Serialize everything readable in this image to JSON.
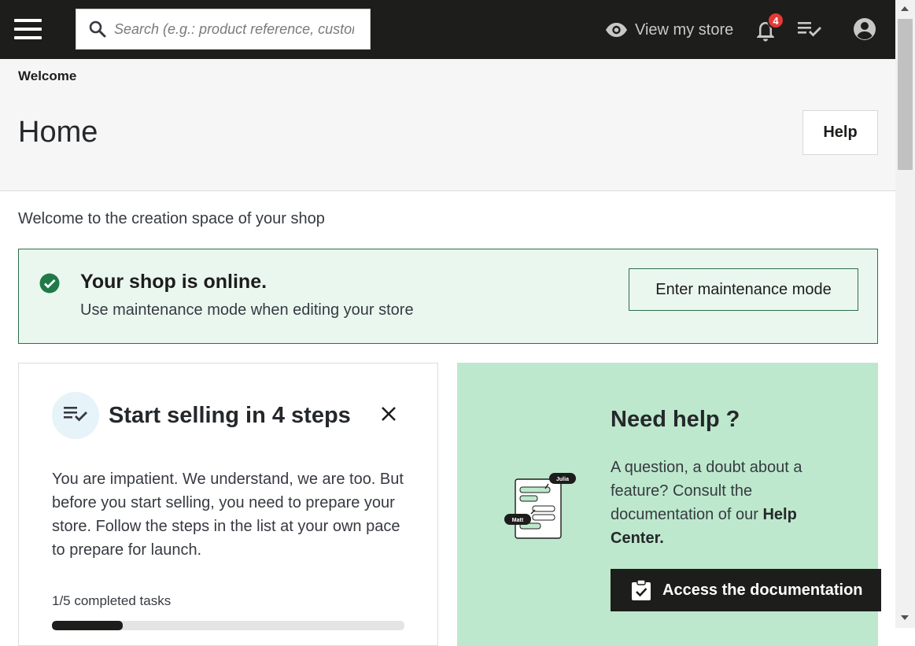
{
  "topbar": {
    "search_placeholder": "Search (e.g.: product reference, customer name…)",
    "view_store_label": "View my store",
    "notifications_count": "4"
  },
  "header": {
    "breadcrumb": "Welcome",
    "title": "Home",
    "help_label": "Help"
  },
  "welcome_text": "Welcome to the creation space of your shop",
  "online_banner": {
    "title": "Your shop is online.",
    "subtitle": "Use maintenance mode when editing your store",
    "button_label": "Enter maintenance mode"
  },
  "steps_card": {
    "title": "Start selling in 4 steps",
    "description": "You are impatient. We understand, we are too. But before you start selling, you need to prepare your store. Follow the steps in the list at your own pace to prepare for launch.",
    "progress_label": "1/5 completed tasks",
    "progress_fraction": 0.2
  },
  "help_card": {
    "title": "Need help ?",
    "text_prefix": "A question, a doubt about a feature? Consult the documentation of our ",
    "text_bold": "Help Center.",
    "illustration_names": [
      "Julia",
      "Matt"
    ],
    "button_label": "Access the documentation"
  },
  "colors": {
    "topbar_bg": "#1d1d1b",
    "success_green": "#1f7a48",
    "banner_bg": "#eaf7ef",
    "help_card_bg": "#bde8cd",
    "badge_red": "#e53935"
  }
}
